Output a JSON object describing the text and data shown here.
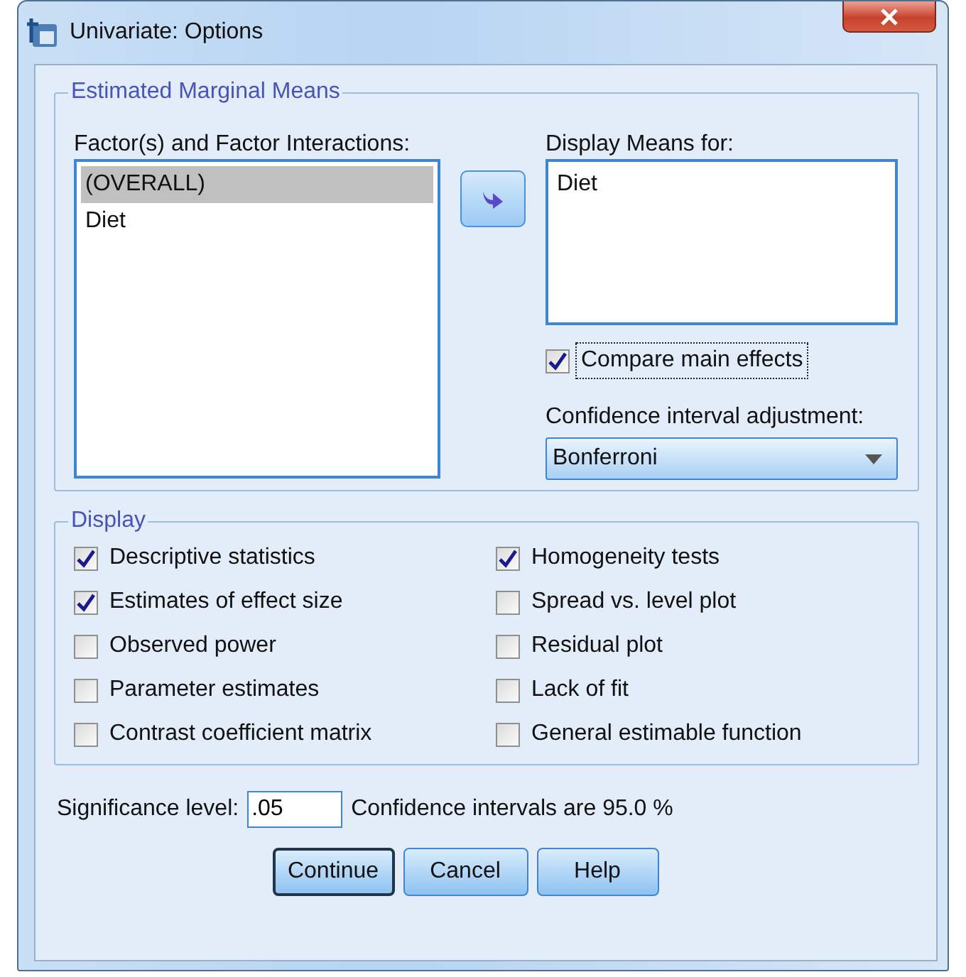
{
  "window": {
    "title": "Univariate: Options"
  },
  "marginal_means": {
    "title": "Estimated Marginal Means",
    "factors": {
      "label": "Factor(s) and Factor Interactions:",
      "items": [
        {
          "label": "(OVERALL)",
          "selected": true
        },
        {
          "label": "Diet",
          "selected": false
        }
      ]
    },
    "display_means": {
      "label": "Display Means for:",
      "items": [
        {
          "label": "Diet",
          "selected": false
        }
      ]
    },
    "compare_main_effects": {
      "label": "Compare main effects",
      "checked": true,
      "focused": true
    },
    "adjustment": {
      "label": "Confidence interval adjustment:",
      "value": "Bonferroni"
    }
  },
  "display": {
    "title": "Display",
    "options": [
      {
        "label": "Descriptive statistics",
        "checked": true
      },
      {
        "label": "Homogeneity tests",
        "checked": true
      },
      {
        "label": "Estimates of effect size",
        "checked": true
      },
      {
        "label": "Spread vs. level plot",
        "checked": false
      },
      {
        "label": "Observed power",
        "checked": false
      },
      {
        "label": "Residual plot",
        "checked": false
      },
      {
        "label": "Parameter estimates",
        "checked": false
      },
      {
        "label": "Lack of fit",
        "checked": false
      },
      {
        "label": "Contrast coefficient matrix",
        "checked": false
      },
      {
        "label": "General estimable function",
        "checked": false
      }
    ]
  },
  "significance": {
    "label": "Significance level:",
    "value": ".05",
    "note": "Confidence intervals are 95.0 %"
  },
  "buttons": [
    {
      "label": "Continue",
      "default": true
    },
    {
      "label": "Cancel",
      "default": false
    },
    {
      "label": "Help",
      "default": false
    }
  ]
}
